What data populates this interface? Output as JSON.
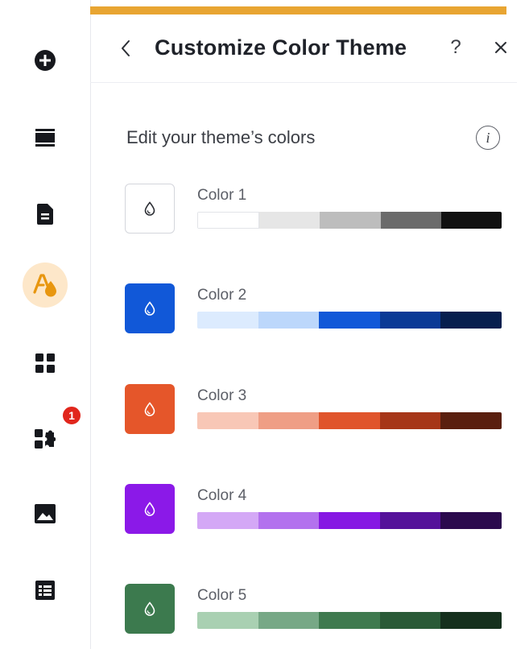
{
  "panel": {
    "title": "Customize Color Theme",
    "help": "?",
    "section_label": "Edit your theme’s colors",
    "info": "i"
  },
  "rail": {
    "items": [
      {
        "icon": "add-icon"
      },
      {
        "icon": "layout-icon"
      },
      {
        "icon": "page-icon"
      },
      {
        "icon": "theme-icon",
        "active": true
      },
      {
        "icon": "apps-icon"
      },
      {
        "icon": "puzzle-icon",
        "badge": "1"
      },
      {
        "icon": "media-icon"
      },
      {
        "icon": "table-icon"
      }
    ]
  },
  "colors": [
    {
      "label": "Color 1",
      "swatch": "#ffffff",
      "shades": [
        "#ffffff",
        "#e6e6e6",
        "#bdbdbd",
        "#6b6b6b",
        "#111111"
      ]
    },
    {
      "label": "Color 2",
      "swatch": "#1158d8",
      "shades": [
        "#dcebfe",
        "#bcd7fb",
        "#1158d8",
        "#0a3a96",
        "#071f4e"
      ]
    },
    {
      "label": "Color 3",
      "swatch": "#e5562a",
      "shades": [
        "#f8c7b6",
        "#ef9e85",
        "#e0542b",
        "#a63618",
        "#5a1f0f"
      ]
    },
    {
      "label": "Color 4",
      "swatch": "#8b19e8",
      "shades": [
        "#d4a8f6",
        "#b371ee",
        "#8617e3",
        "#55119a",
        "#2b0a4d"
      ]
    },
    {
      "label": "Color 5",
      "swatch": "#3c7a4e",
      "shades": [
        "#a9d0b2",
        "#77a886",
        "#3f7a4f",
        "#2a5a37",
        "#15301d"
      ]
    }
  ],
  "accent": "#e8a532"
}
